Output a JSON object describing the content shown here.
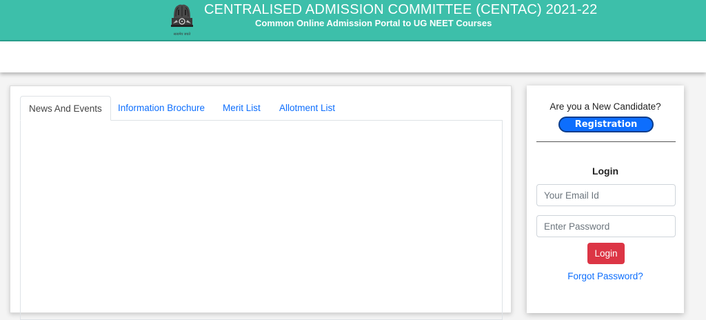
{
  "header": {
    "title": "CENTRALISED ADMISSION COMMITTEE (CENTAC) 2021-22",
    "subtitle": "Common Online Admission Portal to UG NEET Courses",
    "emblem_motto": "सत्यमेव जयते",
    "emblem_icon": "national-emblem-icon",
    "bg_color": "#3dbfaa"
  },
  "tabs": [
    {
      "label": "News And Events",
      "active": true
    },
    {
      "label": "Information Brochure",
      "active": false
    },
    {
      "label": "Merit List",
      "active": false
    },
    {
      "label": "Allotment List",
      "active": false
    }
  ],
  "sidebar": {
    "new_candidate_text": "Are you a New Candidate?",
    "registration_label": "Registration",
    "login_heading": "Login",
    "email_placeholder": "Your Email Id",
    "password_placeholder": "Enter Password",
    "login_button": "Login",
    "forgot_password": "Forgot Password?"
  }
}
